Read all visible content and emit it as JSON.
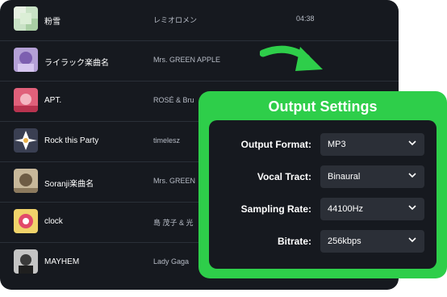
{
  "songs": [
    {
      "title": "粉雪",
      "artist": "レミオロメン",
      "duration": "04:38"
    },
    {
      "title": "ライラック楽曲名",
      "artist": "Mrs. GREEN APPLE",
      "duration": ""
    },
    {
      "title": "APT.",
      "artist": "ROSÉ & Bru",
      "duration": ""
    },
    {
      "title": "Rock this Party",
      "artist": "timelesz",
      "duration": ""
    },
    {
      "title": "Soranji楽曲名",
      "artist": "Mrs. GREEN",
      "duration": ""
    },
    {
      "title": "clock",
      "artist": "島 茂子 & 光",
      "duration": ""
    },
    {
      "title": "MAYHEM",
      "artist": "Lady Gaga",
      "duration": ""
    }
  ],
  "settings": {
    "title": "Output Settings",
    "output_format": {
      "label": "Output Format:",
      "value": "MP3"
    },
    "vocal_tract": {
      "label": "Vocal Tract:",
      "value": "Binaural"
    },
    "sampling_rate": {
      "label": "Sampling Rate:",
      "value": "44100Hz"
    },
    "bitrate": {
      "label": "Bitrate:",
      "value": "256kbps"
    }
  },
  "colors": {
    "accent": "#2ece4a",
    "panel": "#16191f",
    "select": "#2b2f37"
  }
}
